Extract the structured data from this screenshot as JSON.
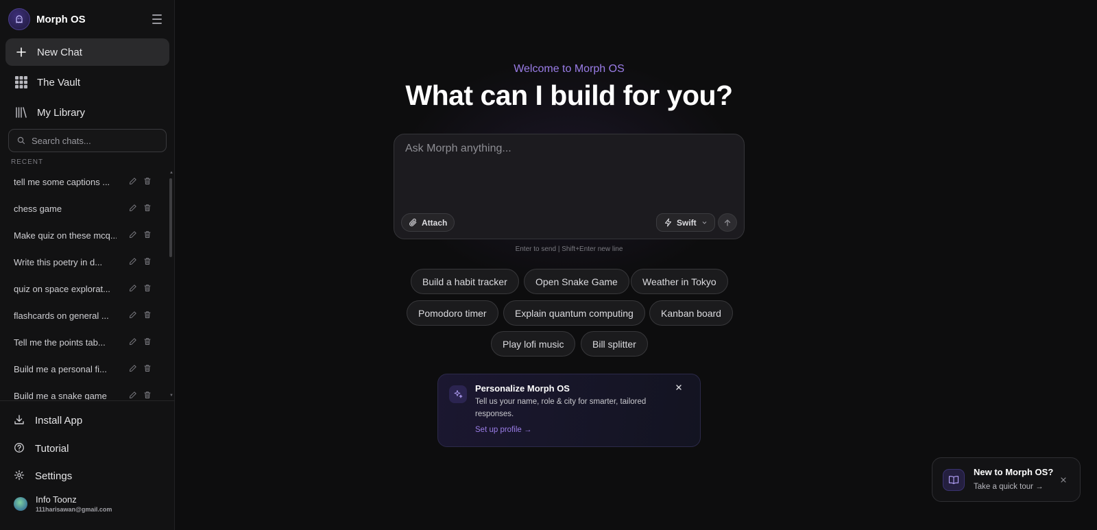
{
  "sidebar": {
    "brand": "Morph OS",
    "nav": [
      {
        "label": "New Chat",
        "icon": "plus-icon"
      },
      {
        "label": "The Vault",
        "icon": "grid-icon"
      },
      {
        "label": "My Library",
        "icon": "library-icon"
      }
    ],
    "search_placeholder": "Search chats...",
    "recent_label": "RECENT",
    "recent": [
      "tell me some captions ...",
      "chess game",
      "Make quiz on these mcq...",
      "Write this poetry in d...",
      "quiz on space explorat...",
      "flashcards on general ...",
      "Tell me the points tab...",
      "Build me a personal fi...",
      "Build me a snake game"
    ],
    "footer": [
      {
        "label": "Install App",
        "icon": "download-icon"
      },
      {
        "label": "Tutorial",
        "icon": "help-icon"
      },
      {
        "label": "Settings",
        "icon": "gear-icon"
      }
    ],
    "user": {
      "name": "Info Toonz",
      "email": "111harisawan@gmail.com"
    }
  },
  "main": {
    "welcome": "Welcome to Morph OS",
    "headline": "What can I build for you?",
    "composer": {
      "placeholder": "Ask Morph anything...",
      "attach_label": "Attach",
      "model_label": "Swift"
    },
    "hint": "Enter to send | Shift+Enter new line",
    "suggestions": [
      "Build a habit tracker",
      "Open Snake Game",
      "Weather in Tokyo",
      "Pomodoro timer",
      "Explain quantum computing",
      "Kanban board",
      "Play lofi music",
      "Bill splitter"
    ],
    "profile_card": {
      "title": "Personalize Morph OS",
      "description": "Tell us your name, role & city for smarter, tailored responses.",
      "link": "Set up profile →"
    }
  },
  "toast": {
    "title": "New to Morph OS?",
    "link": "Take a quick tour →"
  },
  "colors": {
    "accent": "#9b7de8",
    "background": "#0d0d0e",
    "sidebar": "#121213"
  }
}
